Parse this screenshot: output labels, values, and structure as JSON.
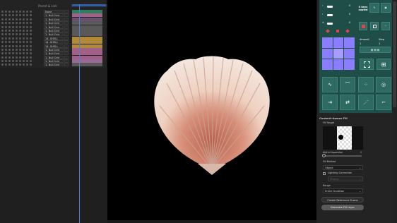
{
  "timeline": {
    "parent_link_header": "Parent & Link",
    "time_markers": [
      "00s",
      "02s"
    ],
    "layers": [
      {
        "label": "None",
        "bar_color": "#2f7f5f"
      },
      {
        "label": "1. Null Cntr",
        "bar_color": "#a06088"
      },
      {
        "label": "1. Null Cntr",
        "bar_color": "#6a4f70"
      },
      {
        "label": "1. Null Cntr",
        "bar_color": "#595959"
      },
      {
        "label": "1. Null Cntr",
        "bar_color": "#595959"
      },
      {
        "label": "1. Null Cntr",
        "bar_color": "#595959"
      },
      {
        "label": "1. Null Cntr",
        "bar_color": "#595959"
      },
      {
        "label": "14. SHELL",
        "bar_color": "#b08a3a"
      },
      {
        "label": "14. SHELL",
        "bar_color": "#b08a3a"
      },
      {
        "label": "14. SHELL",
        "bar_color": "#b08a3a"
      },
      {
        "label": "1. Null Cntr",
        "bar_color": "#a06088"
      },
      {
        "label": "1. Null Cntr",
        "bar_color": "#a06088"
      },
      {
        "label": "1. Null Cntr",
        "bar_color": "#a06088"
      },
      {
        "label": "1. Null Cntr",
        "bar_color": "#9a6a96"
      },
      {
        "label": "1. Null Cntr",
        "bar_color": "#595959"
      }
    ]
  },
  "keyframes_panel": {
    "counters": [
      {
        "symbol": "‹",
        "value": "0"
      },
      {
        "symbol": "‹",
        "value": "0"
      },
      {
        "symbol": "×",
        "value": "0"
      }
    ],
    "copied_label": "0 keys\ncopied",
    "amount_label": "Amount",
    "amount_value": "1",
    "step_label": "Step",
    "step_value": "1",
    "accent": "#8a7dff"
  },
  "content_aware_fill": {
    "title": "Content-Aware Fill",
    "fill_target_label": "Fill Target",
    "alpha_expansion_label": "Alpha Expansion",
    "alpha_expansion_value": "0",
    "fill_method_label": "Fill Method",
    "fill_method_value": "Object",
    "lighting_correction_label": "Lighting Correction",
    "lighting_value": "Strong",
    "range_label": "Range",
    "range_value": "Entire Duration",
    "create_reference_label": "Create Reference Frame",
    "generate_label": "Generate Fill Layer"
  }
}
